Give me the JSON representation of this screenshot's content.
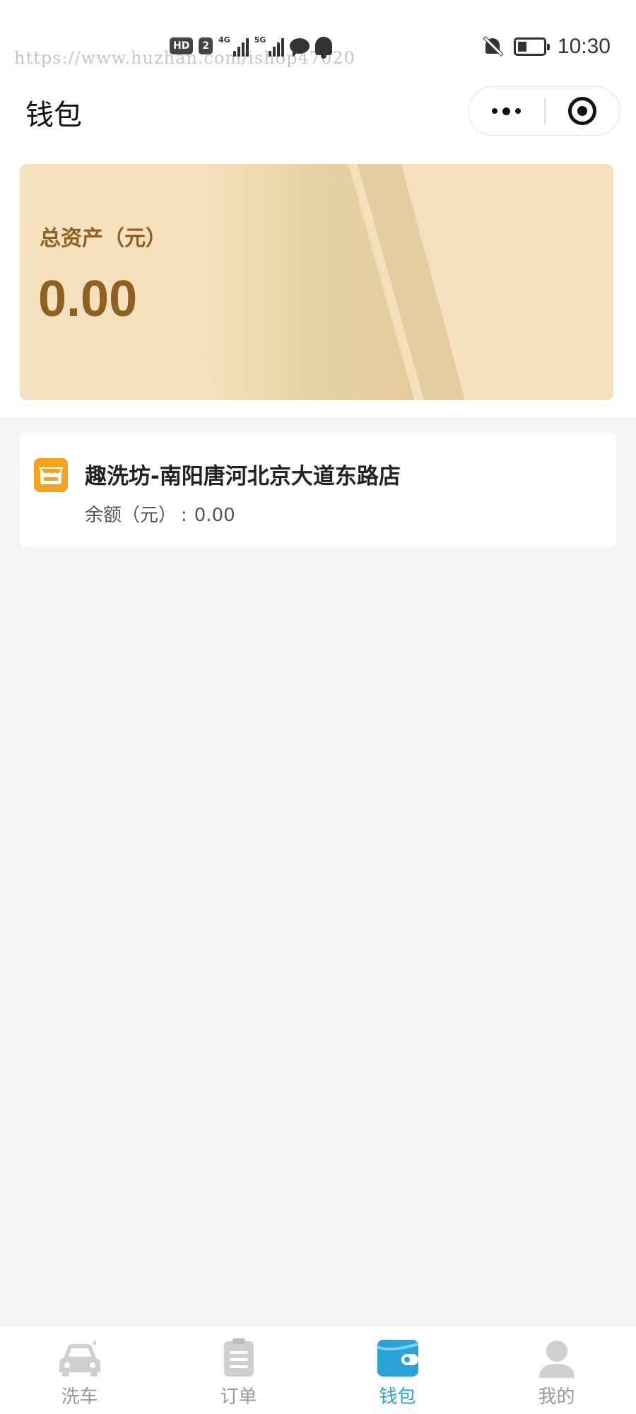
{
  "status_bar": {
    "watermark": "https://www.huzhan.com/ishop47020",
    "hd": "HD",
    "sim": "2",
    "net1": "4G",
    "net2": "5G",
    "time": "10:30",
    "battery_level": 0.35
  },
  "nav": {
    "title": "钱包"
  },
  "wallet": {
    "total_label": "总资产（元）",
    "total_value": "0.00"
  },
  "stores": [
    {
      "name": "趣洗坊-南阳唐河北京大道东路店",
      "balance_label": "余额（元）",
      "balance_sep": ":",
      "balance_value": "0.00"
    }
  ],
  "tabs": [
    {
      "label": "洗车",
      "icon": "car-icon",
      "active": false
    },
    {
      "label": "订单",
      "icon": "order-icon",
      "active": false
    },
    {
      "label": "钱包",
      "icon": "wallet-icon",
      "active": true
    },
    {
      "label": "我的",
      "icon": "user-icon",
      "active": false
    }
  ],
  "colors": {
    "accent": "#2aa2d8",
    "card_bg": "#f5e1bd",
    "card_text": "#8e6121",
    "store_icon": "#f4a31c",
    "inactive_tab": "#c9c9c9"
  }
}
